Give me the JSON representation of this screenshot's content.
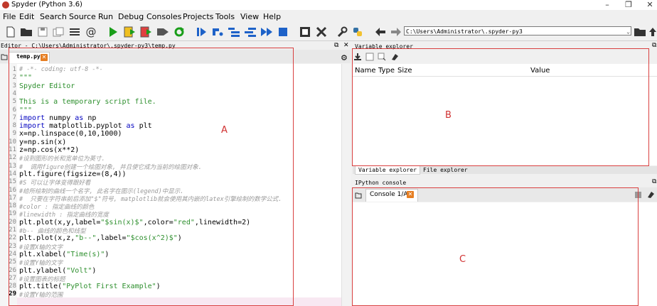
{
  "window": {
    "title": "Spyder (Python 3.6)",
    "minimize": "–",
    "maximize": "❐",
    "close": "✕"
  },
  "menu": [
    "File",
    "Edit",
    "Search",
    "Source",
    "Run",
    "Debug",
    "Consoles",
    "Projects",
    "Tools",
    "View",
    "Help"
  ],
  "toolbar": {
    "working_dir": "C:\\Users\\Administrator\\.spyder-py3"
  },
  "editor": {
    "pane_title": "Editor - C:\\Users\\Administrator\\.spyder-py3\\temp.py",
    "tab_label": "temp.py",
    "current_line": 29,
    "lines": [
      "# -*- coding: utf-8 -*-",
      "\"\"\"",
      "Spyder Editor",
      "",
      "This is a temporary script file.",
      "\"\"\"",
      "import numpy as np",
      "import matplotlib.pyplot as plt",
      "x=np.linspace(0,10,1000)",
      "y=np.sin(x)",
      "z=np.cos(x**2)",
      "#设到图形的长和宽单位为英寸.",
      "#  调用figure创建一个绘图对象, 并且使它成为当前的绘图对象.",
      "plt.figure(figsize=(8,4))",
      "#S 可以让字体变得跟好看",
      "#给所绘制的曲线一个名字, 此名字在图示(legend)中显示.",
      "#  只要在字符串前后添加\"$\"符号, matplotlib就会使用其内嵌的latex引擎绘制的数学公式.",
      "#color : 指定曲线的颜色",
      "#linewidth : 指定曲线的宽度",
      "plt.plot(x,y,label=\"$sin(x)$\",color=\"red\",linewidth=2)",
      "#b-- 曲线的颜色和线型",
      "plt.plot(x,z,\"b--\",label=\"$cos(x^2)$\")",
      "#设置X轴的文字",
      "plt.xlabel(\"Time(s)\")",
      "#设置Y轴的文字",
      "plt.ylabel(\"Volt\")",
      "#设置图表的标题",
      "plt.title(\"PyPlot First Example\")",
      "#设置Y轴的范围"
    ]
  },
  "variable_explorer": {
    "pane_title": "Variable explorer",
    "columns": [
      "Name",
      "Type",
      "Size",
      "Value"
    ],
    "tabs": [
      "Variable explorer",
      "File explorer"
    ]
  },
  "console": {
    "pane_title": "IPython console",
    "tab_label": "Console 1/A"
  },
  "annotations": {
    "a": "A",
    "b": "B",
    "c": "C"
  },
  "colors": {
    "annotation_red": "#d94040",
    "run_green": "#1a9e1a",
    "accent_blue": "#1e62c8",
    "tab_close_orange": "#e67e22"
  }
}
